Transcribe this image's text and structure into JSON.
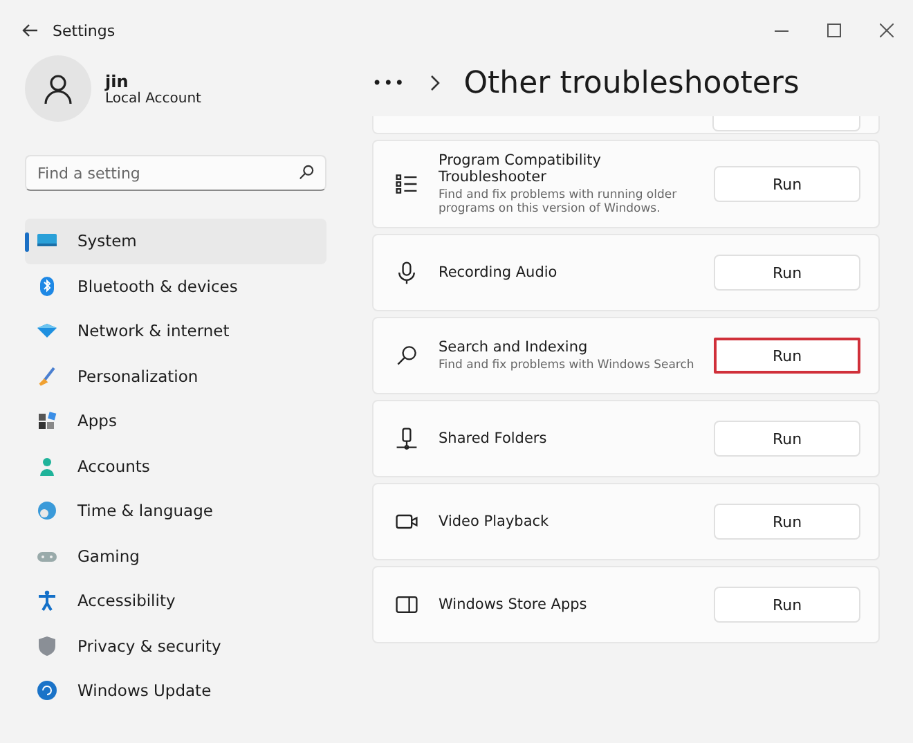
{
  "window": {
    "title": "Settings"
  },
  "account": {
    "name": "jin",
    "type": "Local Account"
  },
  "search": {
    "placeholder": "Find a setting"
  },
  "sidebar": {
    "items": [
      {
        "label": "System",
        "kind": "system",
        "selected": true
      },
      {
        "label": "Bluetooth & devices",
        "kind": "bluetooth",
        "selected": false
      },
      {
        "label": "Network & internet",
        "kind": "network",
        "selected": false
      },
      {
        "label": "Personalization",
        "kind": "brush",
        "selected": false
      },
      {
        "label": "Apps",
        "kind": "apps",
        "selected": false
      },
      {
        "label": "Accounts",
        "kind": "person",
        "selected": false
      },
      {
        "label": "Time & language",
        "kind": "globe",
        "selected": false
      },
      {
        "label": "Gaming",
        "kind": "gamepad",
        "selected": false
      },
      {
        "label": "Accessibility",
        "kind": "accessibility",
        "selected": false
      },
      {
        "label": "Privacy & security",
        "kind": "shield",
        "selected": false
      },
      {
        "label": "Windows Update",
        "kind": "update",
        "selected": false
      }
    ]
  },
  "header": {
    "breadcrumb_overflow": "•••",
    "title": "Other troubleshooters"
  },
  "troubleshooters": [
    {
      "title": "Program Compatibility Troubleshooter",
      "description": "Find and fix problems with running older programs on this version of Windows.",
      "kind": "list",
      "button": "Run",
      "highlighted": false
    },
    {
      "title": "Recording Audio",
      "kind": "mic",
      "button": "Run",
      "highlighted": false
    },
    {
      "title": "Search and Indexing",
      "description": "Find and fix problems with Windows Search",
      "kind": "search",
      "button": "Run",
      "highlighted": true
    },
    {
      "title": "Shared Folders",
      "kind": "share",
      "button": "Run",
      "highlighted": false
    },
    {
      "title": "Video Playback",
      "kind": "video",
      "button": "Run",
      "highlighted": false
    },
    {
      "title": "Windows Store Apps",
      "kind": "store",
      "button": "Run",
      "highlighted": false
    }
  ]
}
